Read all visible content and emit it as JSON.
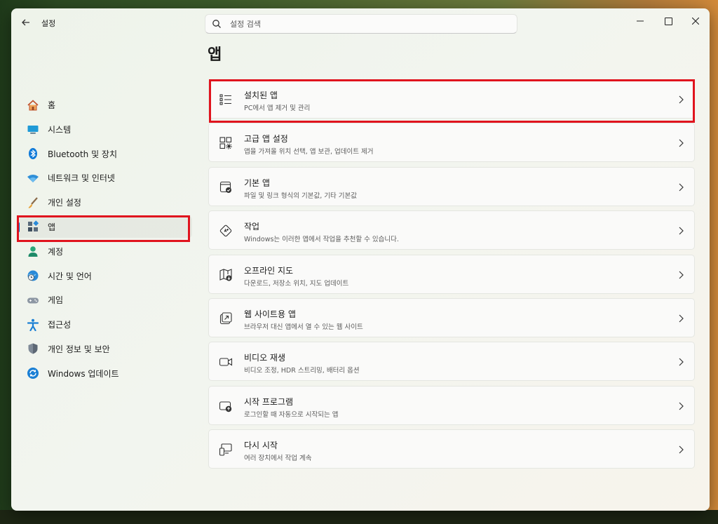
{
  "window": {
    "title": "설정",
    "search_placeholder": "설정 검색"
  },
  "sidebar": {
    "items": [
      {
        "label": "홈",
        "icon": "home-icon"
      },
      {
        "label": "시스템",
        "icon": "system-icon"
      },
      {
        "label": "Bluetooth 및 장치",
        "icon": "bluetooth-icon"
      },
      {
        "label": "네트워크 및 인터넷",
        "icon": "wifi-icon"
      },
      {
        "label": "개인 설정",
        "icon": "brush-icon"
      },
      {
        "label": "앱",
        "icon": "apps-icon",
        "selected": true
      },
      {
        "label": "계정",
        "icon": "account-icon"
      },
      {
        "label": "시간 및 언어",
        "icon": "globe-clock-icon"
      },
      {
        "label": "게임",
        "icon": "gamepad-icon"
      },
      {
        "label": "접근성",
        "icon": "accessibility-icon"
      },
      {
        "label": "개인 정보 및 보안",
        "icon": "shield-icon"
      },
      {
        "label": "Windows 업데이트",
        "icon": "update-icon"
      }
    ]
  },
  "main": {
    "title": "앱",
    "cards": [
      {
        "title": "설치된 앱",
        "subtitle": "PC에서 앱 제거 및 관리",
        "icon": "list-icon"
      },
      {
        "title": "고급 앱 설정",
        "subtitle": "앱을 가져올 위치 선택, 앱 보관, 업데이트 제거",
        "icon": "app-settings-icon"
      },
      {
        "title": "기본 앱",
        "subtitle": "파일 및 링크 형식의 기본값, 기타 기본값",
        "icon": "default-apps-icon"
      },
      {
        "title": "작업",
        "subtitle": "Windows는 이러한 앱에서 작업을 추천할 수 있습니다.",
        "icon": "actions-icon"
      },
      {
        "title": "오프라인 지도",
        "subtitle": "다운로드, 저장소 위치, 지도 업데이트",
        "icon": "map-icon"
      },
      {
        "title": "웹 사이트용 앱",
        "subtitle": "브라우저 대신 앱에서 열 수 있는 웹 사이트",
        "icon": "open-external-icon"
      },
      {
        "title": "비디오 재생",
        "subtitle": "비디오 조정, HDR 스트리밍, 배터리 옵션",
        "icon": "video-icon"
      },
      {
        "title": "시작 프로그램",
        "subtitle": "로그인할 때 자동으로 시작되는 앱",
        "icon": "startup-icon"
      },
      {
        "title": "다시 시작",
        "subtitle": "여러 장치에서 작업 계속",
        "icon": "resume-icon"
      }
    ]
  },
  "colors": {
    "accent": "#0067c0",
    "highlight_box": "#e0141e"
  }
}
